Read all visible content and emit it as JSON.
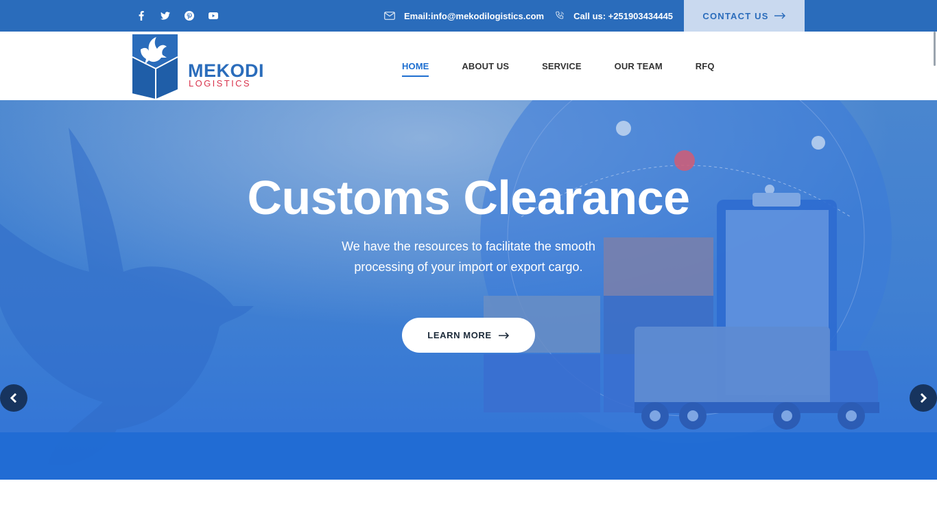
{
  "topbar": {
    "social": [
      {
        "name": "facebook-icon"
      },
      {
        "name": "twitter-icon"
      },
      {
        "name": "pinterest-icon"
      },
      {
        "name": "youtube-icon"
      }
    ],
    "email": "Email:info@mekodilogistics.com",
    "phone": "Call us: +251903434445",
    "contact_button": "CONTACT US"
  },
  "header": {
    "logo": {
      "word1": "MEKODI",
      "word2": "LOGISTICS"
    },
    "nav": [
      {
        "label": "HOME",
        "active": true
      },
      {
        "label": "ABOUT US",
        "active": false
      },
      {
        "label": "SERVICE",
        "active": false
      },
      {
        "label": "OUR TEAM",
        "active": false
      },
      {
        "label": "RFQ",
        "active": false
      }
    ]
  },
  "hero": {
    "title": "Customs Clearance",
    "subtitle_line1": "We have the resources to facilitate the smooth",
    "subtitle_line2": "processing of your import or export cargo.",
    "button": "LEARN MORE"
  },
  "colors": {
    "primary": "#2a6cbb",
    "accent_red": "#d9334d",
    "contact_bg": "#c9d9ef",
    "slider_arrow": "#17345e"
  }
}
